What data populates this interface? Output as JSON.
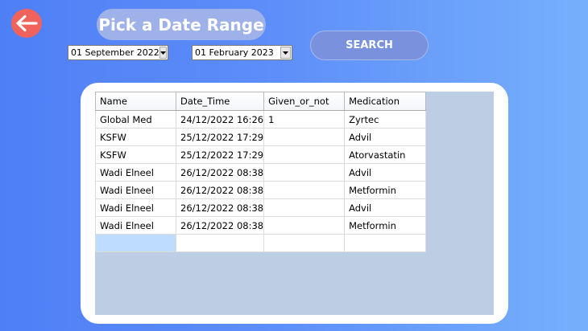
{
  "header": {
    "back_icon": "arrow-left-icon",
    "title": "Pick a Date Range"
  },
  "filters": {
    "start_date": "01 September 2022",
    "end_date": "01 February 2023",
    "search_label": "SEARCH"
  },
  "grid": {
    "columns": [
      "Name",
      "Date_Time",
      "Given_or_not",
      "Medication"
    ],
    "rows": [
      [
        "Global Med",
        "24/12/2022 16:26",
        "1",
        "Zyrtec"
      ],
      [
        "KSFW",
        "25/12/2022 17:29",
        "",
        "Advil"
      ],
      [
        "KSFW",
        "25/12/2022 17:29",
        "",
        "Atorvastatin"
      ],
      [
        "Wadi Elneel",
        "26/12/2022 08:38",
        "",
        "Advil"
      ],
      [
        "Wadi Elneel",
        "26/12/2022 08:38",
        "",
        "Metformin"
      ],
      [
        "Wadi Elneel",
        "26/12/2022 08:38",
        "",
        "Advil"
      ],
      [
        "Wadi Elneel",
        "26/12/2022 08:38",
        "",
        "Metformin"
      ]
    ]
  },
  "colors": {
    "background_left": "#4f7ff5",
    "background_right": "#76b0fc",
    "back_button": "#f0625c",
    "title_pill": "#9fb1e9",
    "search_button": "#7a92dd",
    "grid_background": "#bccde4",
    "selected_cell": "#bddcff"
  }
}
